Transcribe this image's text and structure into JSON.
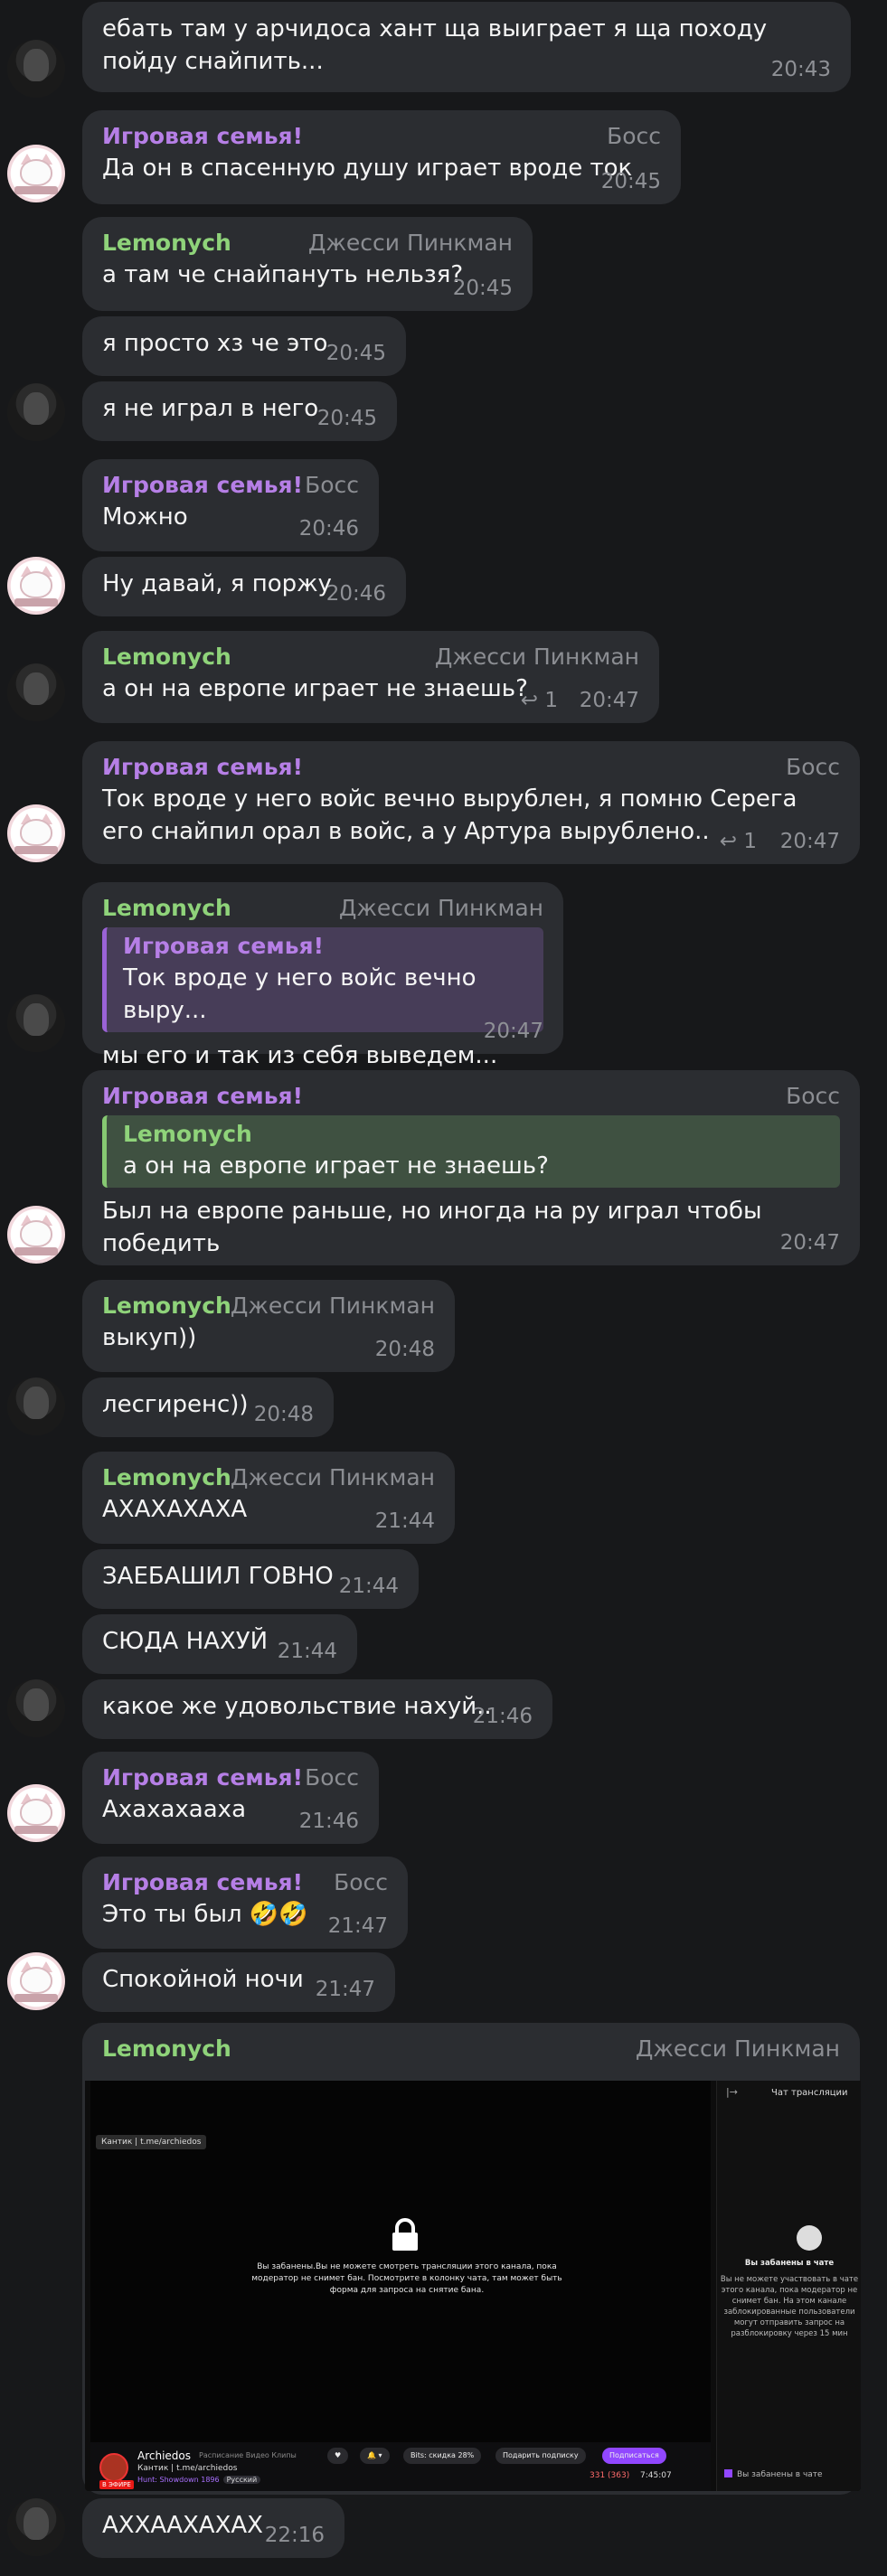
{
  "senders": {
    "family": "Игровая семья!",
    "lemon": "Lemonych"
  },
  "roles": {
    "boss": "Босс",
    "jesse": "Джесси Пинкман"
  },
  "messages": [
    {
      "text": "ебать там у арчидоса хант ща выиграет я ща походу пойду снайпить...",
      "time": "20:43"
    },
    {
      "text": "Да он в спасенную душу играет вроде ток",
      "time": "20:45"
    },
    {
      "text": "а там че снайпануть нельзя?",
      "time": "20:45"
    },
    {
      "text": "я просто хз че это",
      "time": "20:45"
    },
    {
      "text": "я не играл в него",
      "time": "20:45"
    },
    {
      "text": "Можно",
      "time": "20:46"
    },
    {
      "text": "Ну давай, я поржу",
      "time": "20:46"
    },
    {
      "text": "а он на европе играет не знаешь?",
      "time": "20:47",
      "replies": "1"
    },
    {
      "text": "Ток вроде у него войс вечно вырублен, я помню Серега его снайпил орал в войс, а у Артура вырублено..",
      "time": "20:47",
      "replies": "1"
    },
    {
      "text": "мы его и так из себя выведем...",
      "time": "20:47",
      "quote_text": "Ток вроде у него войс вечно выру..."
    },
    {
      "text": "Был на европе раньше, но иногда на ру играл чтобы победить",
      "time": "20:47",
      "quote_text": "а он на европе играет не знаешь?"
    },
    {
      "text": "выкуп))",
      "time": "20:48"
    },
    {
      "text": "лесгиренс))",
      "time": "20:48"
    },
    {
      "text": "АХАХАХАХА",
      "time": "21:44"
    },
    {
      "text": "ЗАЕБАШИЛ ГОВНО",
      "time": "21:44"
    },
    {
      "text": "СЮДА НАХУЙ",
      "time": "21:44"
    },
    {
      "text": "какое же удовольствие нахуй..",
      "time": "21:46"
    },
    {
      "text": "Ахахахааха",
      "time": "21:46"
    },
    {
      "text": "Это ты был 🤣🤣",
      "time": "21:47"
    },
    {
      "text": "Спокойной ночи",
      "time": "21:47"
    },
    {
      "text": "АХХААХАХАХ",
      "time": "22:16"
    }
  ],
  "screenshot": {
    "channel_tag": "Кантик | t.me/archiedos",
    "ban_text": "Вы забанены.Вы не можете смотреть трансляции этого канала, пока модератор не снимет бан. Посмотрите в колонку чата, там может быть форма для запроса на снятие бана.",
    "chat_title": "Чат трансляции",
    "chat_banned_title": "Вы забанены в чате",
    "chat_banned_text": "Вы не можете участвовать в чате этого канала, пока модератор не снимет бан. На этом канале заблокированные пользователи могут отправить запрос на разблокировку через 15 мин",
    "chat_bottom": "Вы забанены в чате",
    "channel_name": "Archiedos",
    "channel_links": "Расписание   Видео   Клипы",
    "stream_title": "Кантик | t.me/archiedos",
    "game": "Hunt: Showdown 1896",
    "lang": "Русский",
    "live": "В ЭФИРЕ",
    "bits": "Bits: скидка 28%",
    "gift": "Подарить подписку",
    "subscribe": "Подписаться",
    "viewers": "331 (363)",
    "uptime": "7:45:07"
  }
}
